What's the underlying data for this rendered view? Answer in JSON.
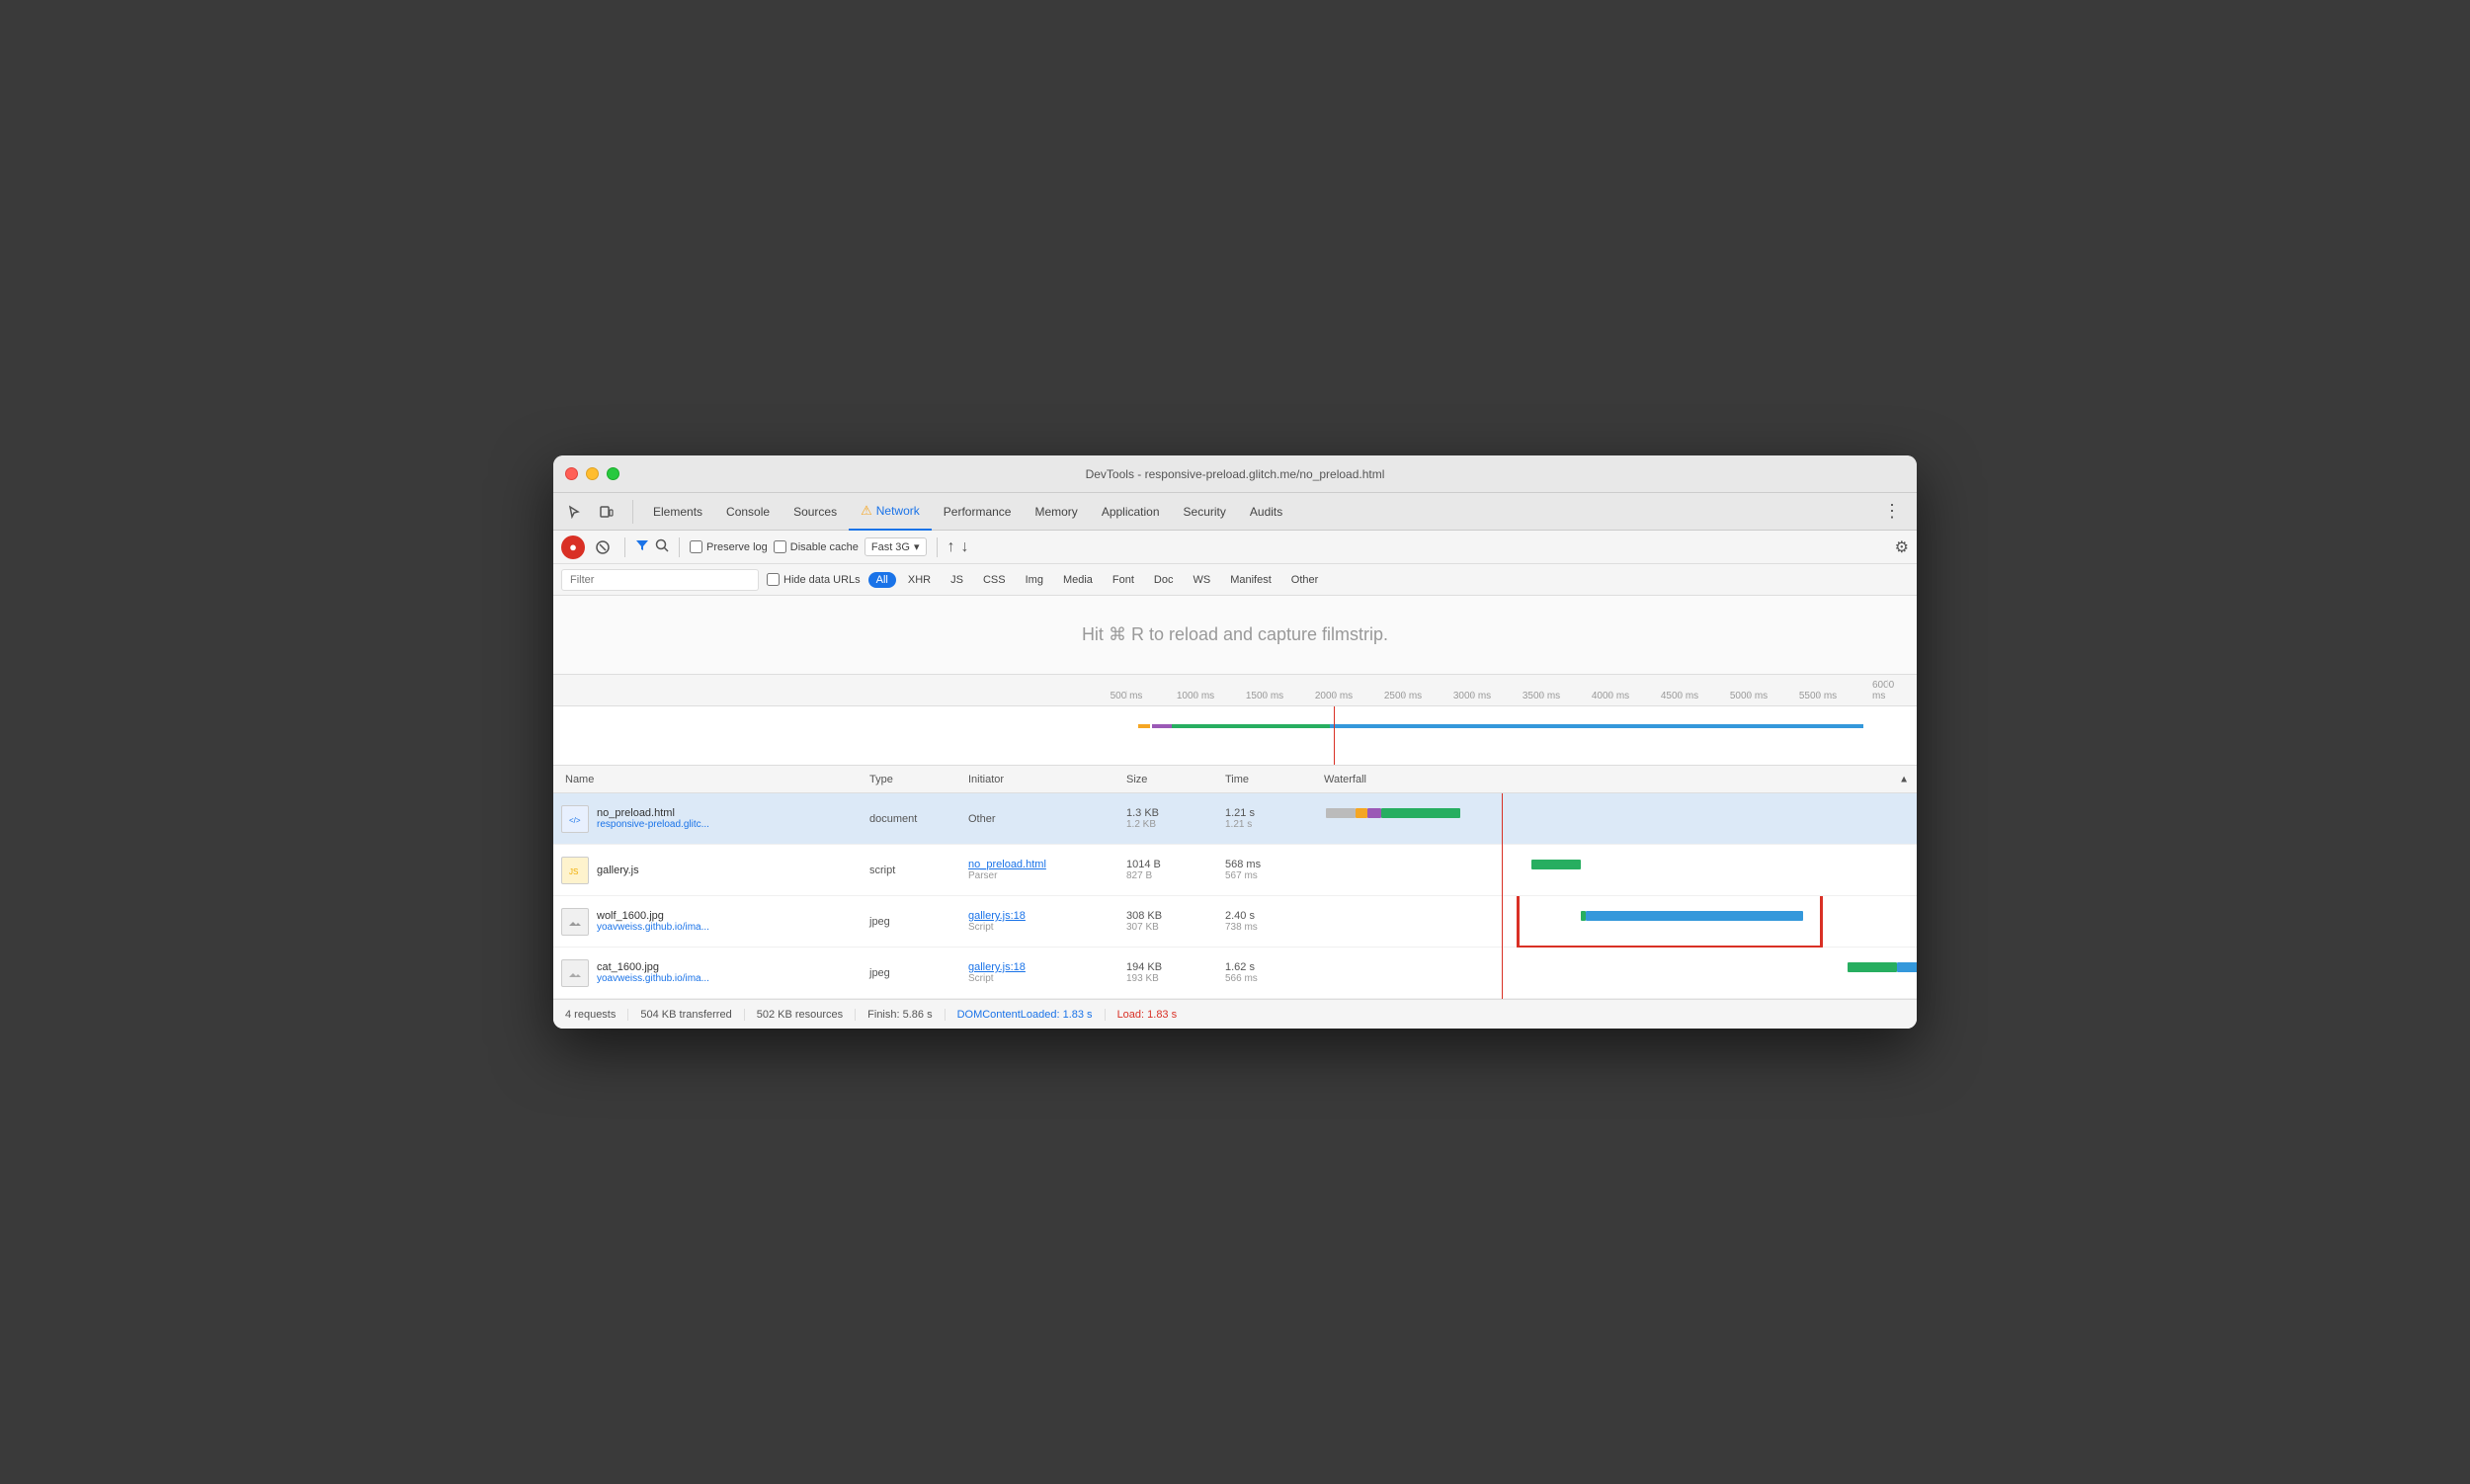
{
  "window": {
    "title": "DevTools - responsive-preload.glitch.me/no_preload.html"
  },
  "nav": {
    "tabs": [
      {
        "id": "elements",
        "label": "Elements",
        "active": false
      },
      {
        "id": "console",
        "label": "Console",
        "active": false
      },
      {
        "id": "sources",
        "label": "Sources",
        "active": false
      },
      {
        "id": "network",
        "label": "Network",
        "active": true,
        "warning": true
      },
      {
        "id": "performance",
        "label": "Performance",
        "active": false
      },
      {
        "id": "memory",
        "label": "Memory",
        "active": false
      },
      {
        "id": "application",
        "label": "Application",
        "active": false
      },
      {
        "id": "security",
        "label": "Security",
        "active": false
      },
      {
        "id": "audits",
        "label": "Audits",
        "active": false
      }
    ]
  },
  "toolbar": {
    "preserve_log_label": "Preserve log",
    "disable_cache_label": "Disable cache",
    "throttle_label": "Fast 3G"
  },
  "filter": {
    "placeholder": "Filter",
    "hide_data_urls": "Hide data URLs",
    "tags": [
      "All",
      "XHR",
      "JS",
      "CSS",
      "Img",
      "Media",
      "Font",
      "Doc",
      "WS",
      "Manifest",
      "Other"
    ]
  },
  "filmstrip": {
    "hint": "Hit ⌘ R to reload and capture filmstrip."
  },
  "timeline": {
    "ticks": [
      "500 ms",
      "1000 ms",
      "1500 ms",
      "2000 ms",
      "2500 ms",
      "3000 ms",
      "3500 ms",
      "4000 ms",
      "4500 ms",
      "5000 ms",
      "5500 ms",
      "6000 ms"
    ]
  },
  "table": {
    "headers": {
      "name": "Name",
      "type": "Type",
      "initiator": "Initiator",
      "size": "Size",
      "time": "Time",
      "waterfall": "Waterfall"
    },
    "rows": [
      {
        "id": "row1",
        "icon_type": "html",
        "name": "no_preload.html",
        "url": "responsive-preload.glitc...",
        "type": "document",
        "initiator": "Other",
        "initiator_link": null,
        "initiator_sub": null,
        "size1": "1.3 KB",
        "size2": "1.2 KB",
        "time1": "1.21 s",
        "time2": "1.21 s",
        "selected": true
      },
      {
        "id": "row2",
        "icon_type": "js",
        "name": "gallery.js",
        "url": null,
        "type": "script",
        "initiator": "no_preload.html",
        "initiator_sub": "Parser",
        "initiator_link": true,
        "size1": "1014 B",
        "size2": "827 B",
        "time1": "568 ms",
        "time2": "567 ms",
        "selected": false
      },
      {
        "id": "row3",
        "icon_type": "img",
        "name": "wolf_1600.jpg",
        "url": "yoavweiss.github.io/ima...",
        "type": "jpeg",
        "initiator": "gallery.js:18",
        "initiator_sub": "Script",
        "initiator_link": true,
        "size1": "308 KB",
        "size2": "307 KB",
        "time1": "2.40 s",
        "time2": "738 ms",
        "selected": false
      },
      {
        "id": "row4",
        "icon_type": "img",
        "name": "cat_1600.jpg",
        "url": "yoavweiss.github.io/ima...",
        "type": "jpeg",
        "initiator": "gallery.js:18",
        "initiator_sub": "Script",
        "initiator_link": true,
        "size1": "194 KB",
        "size2": "193 KB",
        "time1": "1.62 s",
        "time2": "566 ms",
        "selected": false
      }
    ]
  },
  "status": {
    "requests": "4 requests",
    "transferred": "504 KB transferred",
    "resources": "502 KB resources",
    "finish": "Finish: 5.86 s",
    "dom_content_loaded": "DOMContentLoaded: 1.83 s",
    "load": "Load: 1.83 s"
  }
}
